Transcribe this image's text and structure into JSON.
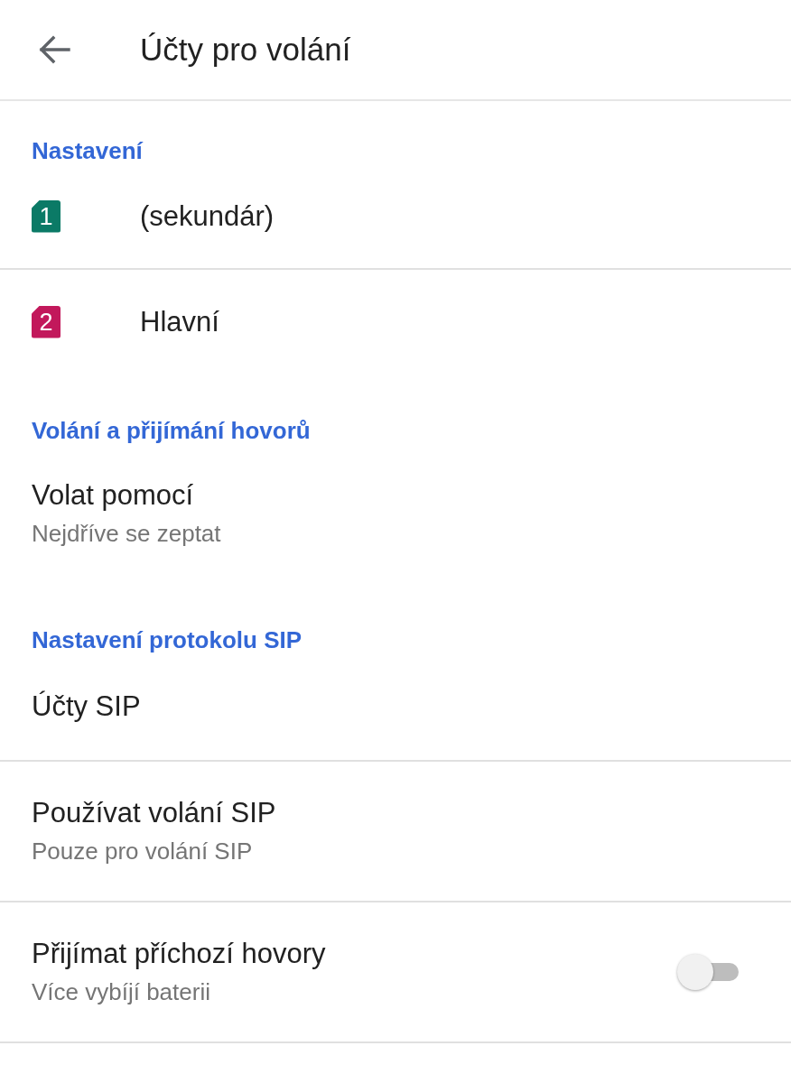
{
  "app_bar": {
    "title": "Účty pro volání"
  },
  "sections": [
    {
      "header": "Nastavení",
      "items": [
        {
          "kind": "sim",
          "number": "1",
          "color": "#0b7a66",
          "title": "(sekundár)",
          "divider": true
        },
        {
          "kind": "sim",
          "number": "2",
          "color": "#c2185b",
          "title": "Hlavní",
          "divider": false
        }
      ]
    },
    {
      "header": "Volání a přijímání hovorů",
      "items": [
        {
          "kind": "text",
          "title": "Volat pomocí",
          "subtitle": "Nejdříve se zeptat",
          "divider": false
        }
      ]
    },
    {
      "header": "Nastavení protokolu SIP",
      "items": [
        {
          "kind": "text",
          "title": "Účty SIP",
          "divider": true
        },
        {
          "kind": "text",
          "title": "Používat volání SIP",
          "subtitle": "Pouze pro volání SIP",
          "divider": true
        },
        {
          "kind": "switch",
          "title": "Přijímat příchozí hovory",
          "subtitle": "Více vybíjí baterii",
          "on": false,
          "divider": true
        }
      ]
    }
  ]
}
